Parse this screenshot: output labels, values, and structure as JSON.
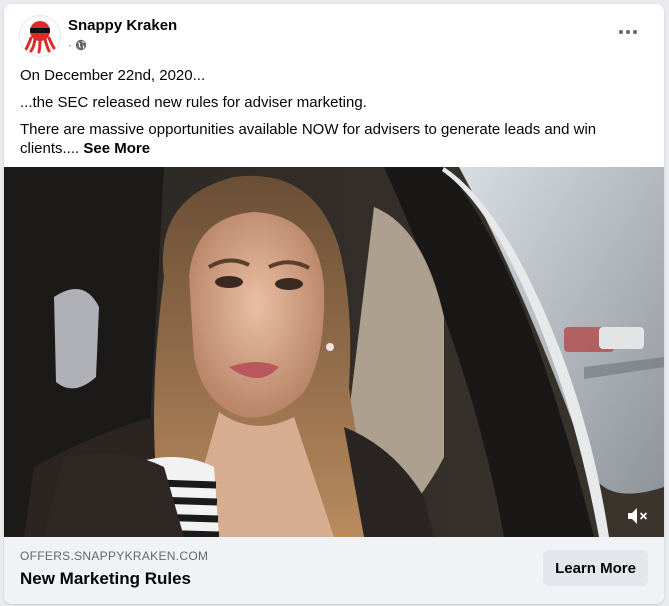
{
  "post": {
    "page_name": "Snappy Kraken",
    "meta_separator": "·",
    "audience_icon": "globe-icon",
    "more_icon": "more-options-icon",
    "text_lines": [
      "On December 22nd, 2020...",
      "...the SEC released new rules for adviser marketing.",
      "There are massive opportunities available NOW for advisers to generate leads and win clients.... "
    ],
    "see_more_label": "See More"
  },
  "media": {
    "type": "video",
    "mute_icon": "speaker-muted-icon"
  },
  "link_preview": {
    "domain": "OFFERS.SNAPPYKRAKEN.COM",
    "headline": "New Marketing Rules",
    "cta_label": "Learn More"
  },
  "colors": {
    "brand_red": "#e02a2a",
    "text_primary": "#050505",
    "text_secondary": "#65676b",
    "footer_bg": "#f0f2f5",
    "button_bg": "#e4e6eb"
  }
}
